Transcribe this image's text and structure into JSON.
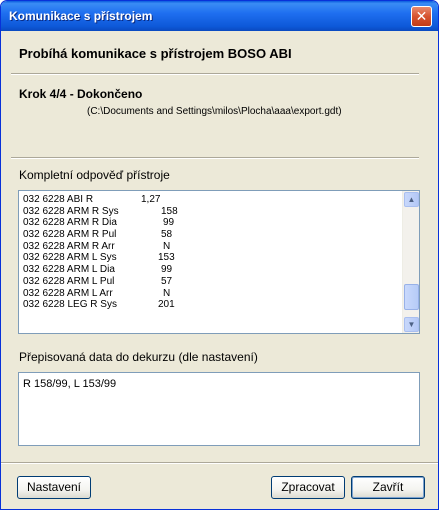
{
  "window": {
    "title": "Komunikace s přístrojem",
    "close_glyph": "✕"
  },
  "header": {
    "heading": "Probíhá komunikace s přístrojem BOSO ABI",
    "step": "Krok 4/4 - Dokončeno",
    "path": "(C:\\Documents and Settings\\milos\\Plocha\\aaa\\export.gdt)"
  },
  "response": {
    "label": "Kompletní odpověď přístroje",
    "lines": [
      {
        "code": "032 6228 ABI R",
        "value": "1,27"
      },
      {
        "code": "032 6228 ARM R Sys",
        "value": "158"
      },
      {
        "code": "032 6228 ARM R Dia",
        "value": "99"
      },
      {
        "code": "032 6228 ARM R Pul",
        "value": "58"
      },
      {
        "code": "032 6228 ARM R Arr",
        "value": "N"
      },
      {
        "code": "032 6228 ARM L Sys",
        "value": "153"
      },
      {
        "code": "032 6228 ARM L Dia",
        "value": "99"
      },
      {
        "code": "032 6228 ARM L Pul",
        "value": "57"
      },
      {
        "code": "032 6228 ARM L Arr",
        "value": "N"
      },
      {
        "code": "032 6228 LEG R Sys",
        "value": "201"
      }
    ],
    "scroll_up_glyph": "▲",
    "scroll_down_glyph": "▼"
  },
  "decursus": {
    "label": "Přepisovaná data do dekurzu (dle nastavení)",
    "value": "R 158/99, L 153/99"
  },
  "buttons": {
    "settings": "Nastavení",
    "process": "Zpracovat",
    "close": "Zavřít"
  },
  "colors": {
    "titlebar": "#0a5bde",
    "face": "#ece9d8",
    "field_border": "#7f9db9"
  }
}
